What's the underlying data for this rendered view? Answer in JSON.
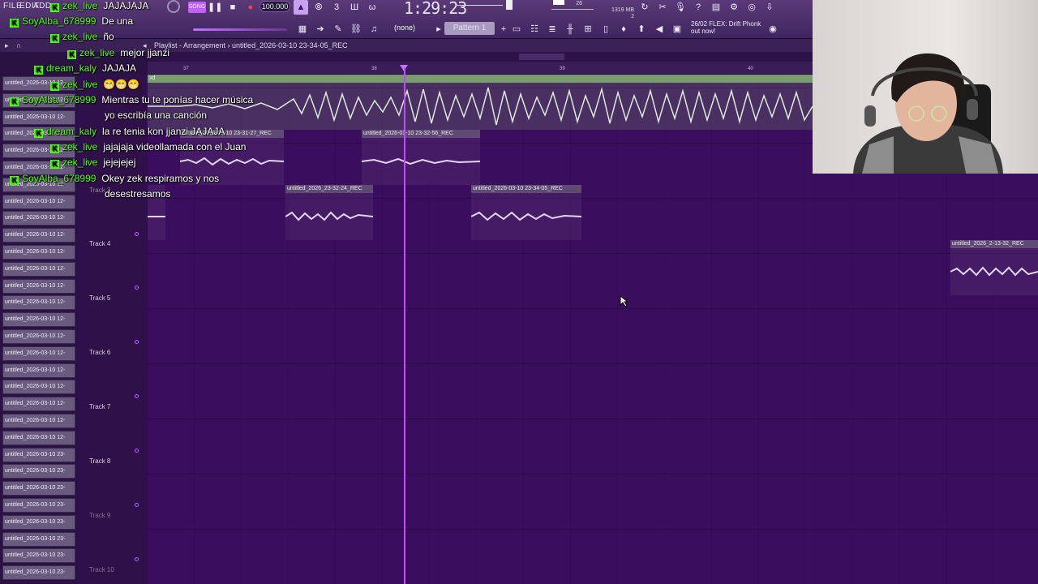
{
  "menu": [
    "FILE",
    "EDIT",
    "ADD"
  ],
  "transport": {
    "tempo": "100.000",
    "song_time": "1:29:23",
    "memory": "1319 MB",
    "memory_secondary": "26",
    "cpu_value": "2",
    "pattern": "Pattern 1",
    "channel_target": "(none)",
    "news_line1": "26/02 FLEX: Drift Phonk",
    "news_line2": "out now!"
  },
  "playlist": {
    "breadcrumb": "Playlist - Arrangement",
    "breadcrumb_clip": "untitled_2026-03-10 23-34-05_REC",
    "bar_numbers": [
      "37",
      "38",
      "39",
      "40"
    ],
    "track1_top_label": "xd",
    "tracks": [
      "Track 3",
      "Track 4",
      "Track 5",
      "Track 6",
      "Track 7",
      "Track 8",
      "Track 9",
      "Track 10"
    ],
    "clips": [
      {
        "name": "untitled_2026-03-10 23-31-27_REC"
      },
      {
        "name": "untitled_2026-03-10 23-32-56_REC"
      },
      {
        "name": "untitled_2026_23-32-24_REC"
      },
      {
        "name": "untitled_2026-03-10 23-34-05_REC"
      },
      {
        "name": "untitled_2026_2-13-32_REC"
      }
    ]
  },
  "browser_items": [
    "untitled_2026-03-10 12-",
    "untitled_2026-03-10 12-",
    "untitled_2026-03-10 12-",
    "untitled_2026-03-10 12-",
    "untitled_2026-03-10 12-",
    "untitled_2026-03-10 12-",
    "untitled_2026-03-10 12-",
    "untitled_2026-03-10 12-",
    "untitled_2026-03-10 12-",
    "untitled_2026-03-10 12-",
    "untitled_2026-03-10 12-",
    "untitled_2026-03-10 12-",
    "untitled_2026-03-10 12-",
    "untitled_2026-03-10 12-",
    "untitled_2026-03-10 12-",
    "untitled_2026-03-10 12-",
    "untitled_2026-03-10 12-",
    "untitled_2026-03-10 12-",
    "untitled_2026-03-10 12-",
    "untitled_2026-03-10 12-",
    "untitled_2026-03-10 12-",
    "untitled_2026-03-10 12-",
    "untitled_2026-03-10 23-",
    "untitled_2026-03-10 23-",
    "untitled_2026-03-10 23-",
    "untitled_2026-03-10 23-",
    "untitled_2026-03-10 23-",
    "untitled_2026-03-10 23-",
    "untitled_2026-03-10 23-",
    "untitled_2026-03-10 23-"
  ],
  "chat": [
    {
      "user": "zek_live",
      "message": "JAJAJAJA"
    },
    {
      "user": "SoyAlba_678999",
      "message": "De una"
    },
    {
      "user": "zek_live",
      "message": "ño"
    },
    {
      "user": "zek_live",
      "message": "mejor jjanzi"
    },
    {
      "user": "dream_kaly",
      "message": "JAJAJA"
    },
    {
      "user": "zek_live",
      "message": "😁😁😁"
    },
    {
      "user": "SoyAlba_678999",
      "message": "Mientras tu te ponías hacer música"
    },
    {
      "user": "",
      "message": "yo escribía una canción"
    },
    {
      "user": "dream_kaly",
      "message": "la re tenia kon jjanzi JAJAJA"
    },
    {
      "user": "zek_live",
      "message": "jajajaja videollamada con el Juan"
    },
    {
      "user": "zek_live",
      "message": "jejejejej"
    },
    {
      "user": "SoyAlba_678999",
      "message": "Okey zek respiramos y nos"
    },
    {
      "user": "",
      "message": "desestresamos"
    }
  ],
  "colors": {
    "accent": "#c04cff",
    "chat_user": "#53fc18",
    "grid_dark": "#280a43",
    "grid_light": "#3a0d5e"
  }
}
